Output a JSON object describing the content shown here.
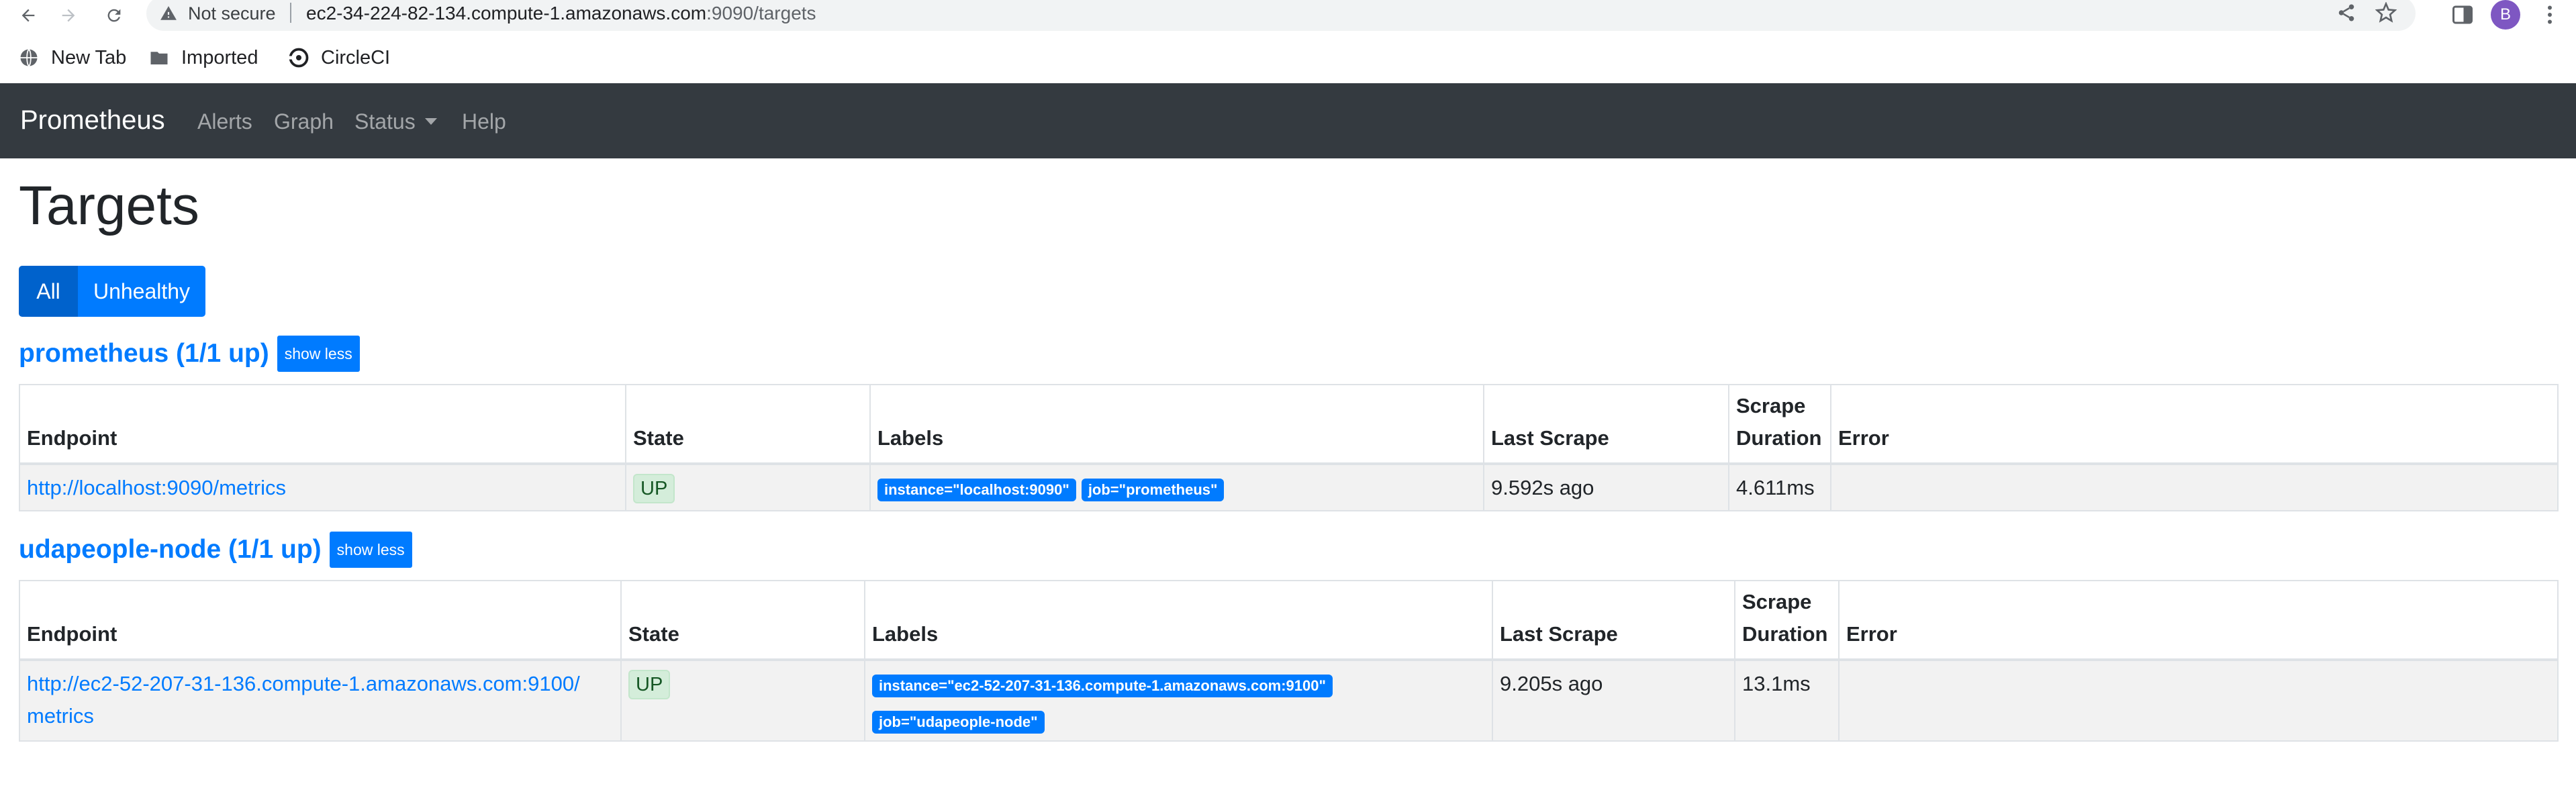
{
  "browser": {
    "security_label": "Not secure",
    "url_host": "ec2-34-224-82-134.compute-1.amazonaws.com",
    "url_path": ":9090/targets",
    "avatar_letter": "B",
    "avatar_color": "#7e57c2",
    "bookmarks": [
      {
        "label": "New Tab",
        "icon": "globe-icon"
      },
      {
        "label": "Imported",
        "icon": "folder-icon"
      },
      {
        "label": "CircleCI",
        "icon": "circleci-icon"
      }
    ]
  },
  "navbar": {
    "brand": "Prometheus",
    "links": [
      "Alerts",
      "Graph",
      "Status",
      "Help"
    ]
  },
  "page": {
    "title": "Targets",
    "filters": {
      "all": "All",
      "unhealthy": "Unhealthy",
      "active": "All"
    }
  },
  "table_headers": {
    "endpoint": "Endpoint",
    "state": "State",
    "labels": "Labels",
    "last_scrape": "Last Scrape",
    "scrape_duration": "Scrape Duration",
    "error": "Error"
  },
  "pools": [
    {
      "title": "prometheus (1/1 up)",
      "toggle": "show less",
      "targets": [
        {
          "endpoint": "http://localhost:9090/metrics",
          "state": "UP",
          "labels": [
            "instance=\"localhost:9090\"",
            "job=\"prometheus\""
          ],
          "last_scrape": "9.592s ago",
          "scrape_duration": "4.611ms",
          "error": ""
        }
      ]
    },
    {
      "title": "udapeople-node (1/1 up)",
      "toggle": "show less",
      "targets": [
        {
          "endpoint_line1": "http://ec2-52-207-31-136.compute-1.amazonaws.com:9100/",
          "endpoint_line2": "metrics",
          "state": "UP",
          "labels": [
            "instance=\"ec2-52-207-31-136.compute-1.amazonaws.com:9100\"",
            "job=\"udapeople-node\""
          ],
          "last_scrape": "9.205s ago",
          "scrape_duration": "13.1ms",
          "error": ""
        }
      ]
    }
  ],
  "colors": {
    "navbar_bg": "#343a40",
    "primary": "#007bff",
    "state_up_bg": "#d4edda",
    "state_up_text": "#155724"
  }
}
